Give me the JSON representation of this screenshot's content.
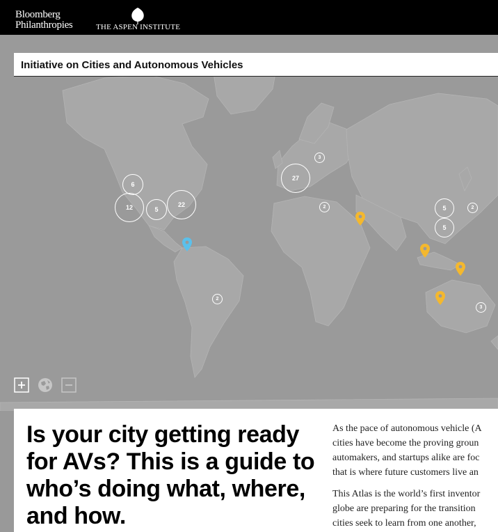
{
  "header": {
    "brand_line1": "Bloomberg",
    "brand_line2": "Philanthropies",
    "partner": "THE ASPEN INSTITUTE"
  },
  "map": {
    "title": "Initiative on Cities and Autonomous Vehicles",
    "clusters": [
      {
        "label": "6"
      },
      {
        "label": "12"
      },
      {
        "label": "5"
      },
      {
        "label": "22"
      },
      {
        "label": "27"
      },
      {
        "label": "3"
      },
      {
        "label": "2"
      },
      {
        "label": "5"
      },
      {
        "label": "5"
      },
      {
        "label": "2"
      },
      {
        "label": "2"
      },
      {
        "label": "3"
      }
    ],
    "pins": [
      "blue",
      "yellow",
      "yellow",
      "yellow",
      "yellow"
    ],
    "colors": {
      "ocean": "#9a9a9a",
      "land": "#a8a8a8",
      "pin_yellow": "#f4b82e",
      "pin_blue": "#5bc0eb"
    },
    "controls": {
      "zoom_in": "plus-icon",
      "reset": "globe-icon",
      "zoom_out": "minus-icon"
    }
  },
  "content": {
    "headline": "Is your city getting ready for AVs? This is a guide to who’s doing what, where, and how.",
    "intro_p1": [
      "As the pace of autonomous vehicle (A",
      "cities have become the proving groun",
      "automakers, and startups alike are foc",
      "that is where future customers live an"
    ],
    "intro_p2": [
      "This Atlas is the world’s first inventor",
      "globe are preparing for the transition",
      "cities seek to learn from one another,"
    ]
  }
}
